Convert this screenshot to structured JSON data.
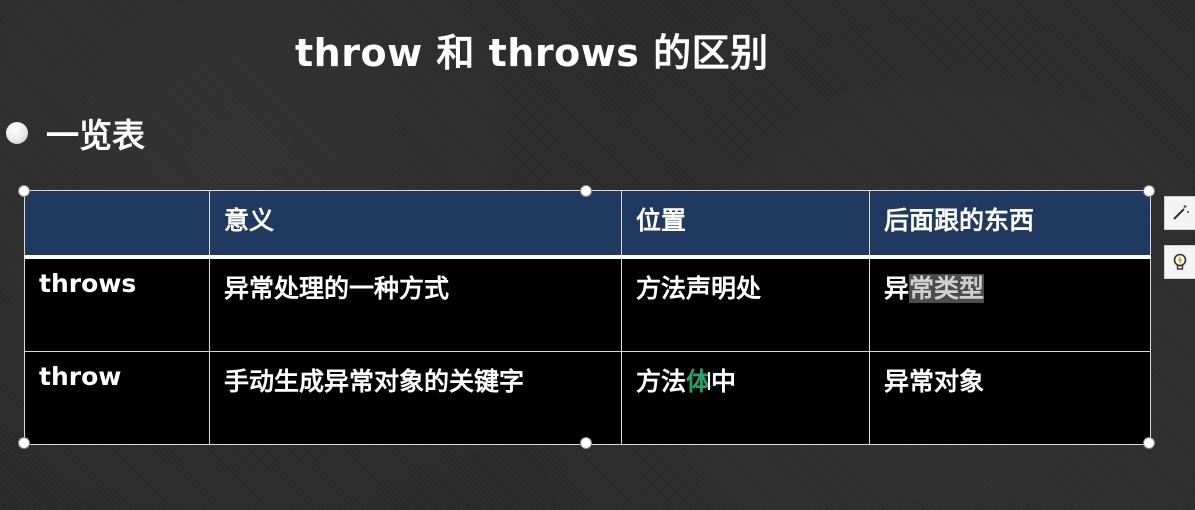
{
  "slide": {
    "title": "throw 和 throws 的区别",
    "bullet": "一览表"
  },
  "table": {
    "headers": [
      "",
      "意义",
      "位置",
      "后面跟的东西"
    ],
    "rows": [
      {
        "keyword": "throws",
        "meaning": "异常处理的一种方式",
        "position": "方法声明处",
        "follows_plain": "异",
        "follows_highlight": "常类型"
      },
      {
        "keyword": "throw",
        "meaning": "手动生成异常对象的关键字",
        "position_pre": "方法",
        "position_green": "体",
        "position_post": "中",
        "follows": "异常对象"
      }
    ]
  },
  "colors": {
    "background": "#2b2b2b",
    "header_fill": "#203a5f",
    "row_fill": "#000000",
    "green_text": "#22a36a"
  },
  "icons": [
    "magic-wand-icon",
    "lightbulb-icon"
  ]
}
